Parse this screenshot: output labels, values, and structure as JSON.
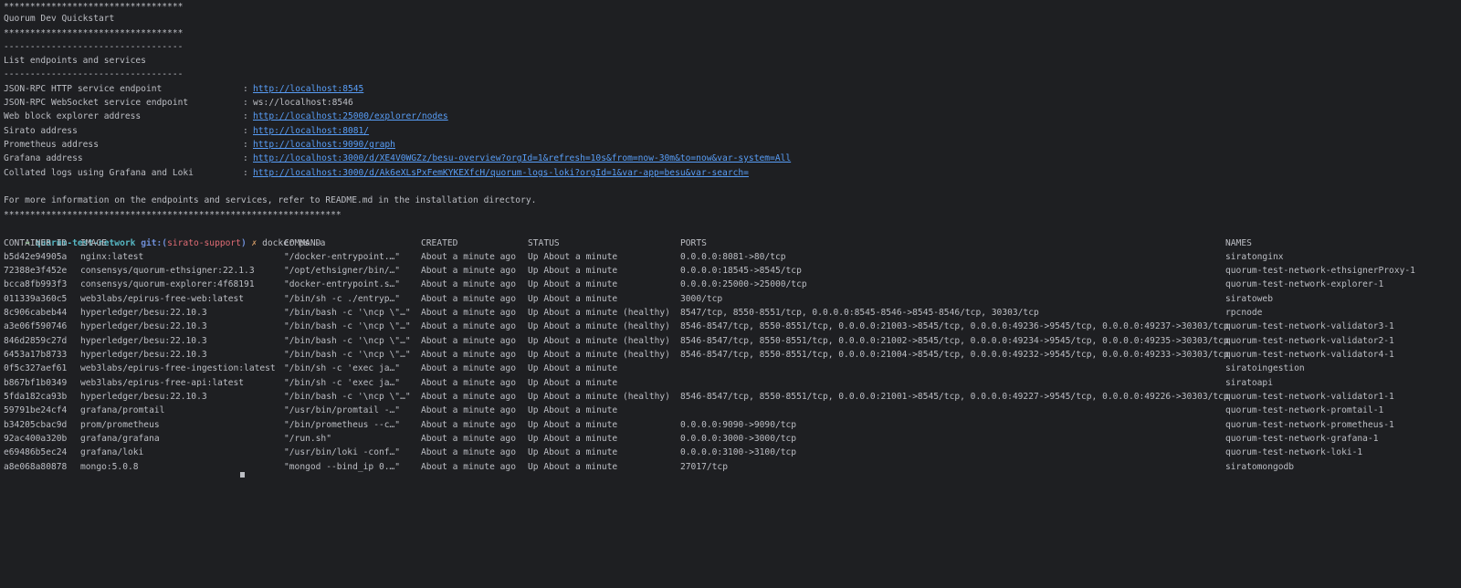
{
  "banner": {
    "stars_top": "**********************************",
    "title": "Quorum Dev Quickstart",
    "stars_bottom": "**********************************",
    "dashes_1": "----------------------------------",
    "list_heading": "List endpoints and services",
    "dashes_2": "----------------------------------"
  },
  "endpoints": [
    {
      "label": "JSON-RPC HTTP service endpoint",
      "value": "http://localhost:8545",
      "is_link": true
    },
    {
      "label": "JSON-RPC WebSocket service endpoint",
      "value": "ws://localhost:8546",
      "is_link": false
    },
    {
      "label": "Web block explorer address",
      "value": "http://localhost:25000/explorer/nodes",
      "is_link": true
    },
    {
      "label": "Sirato address",
      "value": "http://localhost:8081/",
      "is_link": true
    },
    {
      "label": "Prometheus address",
      "value": "http://localhost:9090/graph",
      "is_link": true
    },
    {
      "label": "Grafana address",
      "value": "http://localhost:3000/d/XE4V0WGZz/besu-overview?orgId=1&refresh=10s&from=now-30m&to=now&var-system=All",
      "is_link": true
    },
    {
      "label": "Collated logs using Grafana and Loki",
      "value": "http://localhost:3000/d/Ak6eXLsPxFemKYKEXfcH/quorum-logs-loki?orgId=1&var-app=besu&var-search=",
      "is_link": true
    }
  ],
  "separator": ":",
  "info_text": "For more information on the endpoints and services, refer to README.md in the installation directory.",
  "stars_long": "****************************************************************",
  "prompt": {
    "arrow": "➜",
    "dir": "quorum-test-network",
    "git_open": "git:(",
    "branch": "sirato-support",
    "git_close": ")",
    "mark": "✗",
    "command": "docker ps -a"
  },
  "docker_headers": {
    "container_id": "CONTAINER ID",
    "image": "IMAGE",
    "command": "COMMAND",
    "created": "CREATED",
    "status": "STATUS",
    "ports": "PORTS",
    "names": "NAMES"
  },
  "containers": [
    {
      "id": "b5d42e94905a",
      "image": "nginx:latest",
      "command": "\"/docker-entrypoint.…\"",
      "created": "About a minute ago",
      "status": "Up About a minute",
      "ports": "0.0.0.0:8081->80/tcp",
      "names": "siratonginx"
    },
    {
      "id": "72388e3f452e",
      "image": "consensys/quorum-ethsigner:22.1.3",
      "command": "\"/opt/ethsigner/bin/…\"",
      "created": "About a minute ago",
      "status": "Up About a minute",
      "ports": "0.0.0.0:18545->8545/tcp",
      "names": "quorum-test-network-ethsignerProxy-1"
    },
    {
      "id": "bcca8fb993f3",
      "image": "consensys/quorum-explorer:4f68191",
      "command": "\"docker-entrypoint.s…\"",
      "created": "About a minute ago",
      "status": "Up About a minute",
      "ports": "0.0.0.0:25000->25000/tcp",
      "names": "quorum-test-network-explorer-1"
    },
    {
      "id": "011339a360c5",
      "image": "web3labs/epirus-free-web:latest",
      "command": "\"/bin/sh -c ./entryp…\"",
      "created": "About a minute ago",
      "status": "Up About a minute",
      "ports": "3000/tcp",
      "names": "siratoweb"
    },
    {
      "id": "8c906cabeb44",
      "image": "hyperledger/besu:22.10.3",
      "command": "\"/bin/bash -c '\\ncp \\\"…\"",
      "created": "About a minute ago",
      "status": "Up About a minute (healthy)",
      "ports": "8547/tcp, 8550-8551/tcp, 0.0.0.0:8545-8546->8545-8546/tcp, 30303/tcp",
      "names": "rpcnode"
    },
    {
      "id": "a3e06f590746",
      "image": "hyperledger/besu:22.10.3",
      "command": "\"/bin/bash -c '\\ncp \\\"…\"",
      "created": "About a minute ago",
      "status": "Up About a minute (healthy)",
      "ports": "8546-8547/tcp, 8550-8551/tcp, 0.0.0.0:21003->8545/tcp, 0.0.0.0:49236->9545/tcp, 0.0.0.0:49237->30303/tcp",
      "names": "quorum-test-network-validator3-1"
    },
    {
      "id": "846d2859c27d",
      "image": "hyperledger/besu:22.10.3",
      "command": "\"/bin/bash -c '\\ncp \\\"…\"",
      "created": "About a minute ago",
      "status": "Up About a minute (healthy)",
      "ports": "8546-8547/tcp, 8550-8551/tcp, 0.0.0.0:21002->8545/tcp, 0.0.0.0:49234->9545/tcp, 0.0.0.0:49235->30303/tcp",
      "names": "quorum-test-network-validator2-1"
    },
    {
      "id": "6453a17b8733",
      "image": "hyperledger/besu:22.10.3",
      "command": "\"/bin/bash -c '\\ncp \\\"…\"",
      "created": "About a minute ago",
      "status": "Up About a minute (healthy)",
      "ports": "8546-8547/tcp, 8550-8551/tcp, 0.0.0.0:21004->8545/tcp, 0.0.0.0:49232->9545/tcp, 0.0.0.0:49233->30303/tcp",
      "names": "quorum-test-network-validator4-1"
    },
    {
      "id": "0f5c327aef61",
      "image": "web3labs/epirus-free-ingestion:latest",
      "command": "\"/bin/sh -c 'exec ja…\"",
      "created": "About a minute ago",
      "status": "Up About a minute",
      "ports": "",
      "names": "siratoingestion"
    },
    {
      "id": "b867bf1b0349",
      "image": "web3labs/epirus-free-api:latest",
      "command": "\"/bin/sh -c 'exec ja…\"",
      "created": "About a minute ago",
      "status": "Up About a minute",
      "ports": "",
      "names": "siratoapi"
    },
    {
      "id": "5fda182ca93b",
      "image": "hyperledger/besu:22.10.3",
      "command": "\"/bin/bash -c '\\ncp \\\"…\"",
      "created": "About a minute ago",
      "status": "Up About a minute (healthy)",
      "ports": "8546-8547/tcp, 8550-8551/tcp, 0.0.0.0:21001->8545/tcp, 0.0.0.0:49227->9545/tcp, 0.0.0.0:49226->30303/tcp",
      "names": "quorum-test-network-validator1-1"
    },
    {
      "id": "59791be24cf4",
      "image": "grafana/promtail",
      "command": "\"/usr/bin/promtail -…\"",
      "created": "About a minute ago",
      "status": "Up About a minute",
      "ports": "",
      "names": "quorum-test-network-promtail-1"
    },
    {
      "id": "b34205cbac9d",
      "image": "prom/prometheus",
      "command": "\"/bin/prometheus --c…\"",
      "created": "About a minute ago",
      "status": "Up About a minute",
      "ports": "0.0.0.0:9090->9090/tcp",
      "names": "quorum-test-network-prometheus-1"
    },
    {
      "id": "92ac400a320b",
      "image": "grafana/grafana",
      "command": "\"/run.sh\"",
      "created": "About a minute ago",
      "status": "Up About a minute",
      "ports": "0.0.0.0:3000->3000/tcp",
      "names": "quorum-test-network-grafana-1"
    },
    {
      "id": "e69486b5ec24",
      "image": "grafana/loki",
      "command": "\"/usr/bin/loki -conf…\"",
      "created": "About a minute ago",
      "status": "Up About a minute",
      "ports": "0.0.0.0:3100->3100/tcp",
      "names": "quorum-test-network-loki-1"
    },
    {
      "id": "a8e068a80878",
      "image": "mongo:5.0.8",
      "command": "\"mongod --bind_ip 0.…\"",
      "created": "About a minute ago",
      "status": "Up About a minute",
      "ports": "27017/tcp",
      "names": "siratomongodb"
    }
  ],
  "colors": {
    "background": "#1e1f22",
    "text": "#bcbec4",
    "link": "#589df6",
    "prompt_arrow": "#5fb85f",
    "prompt_dir": "#56b6c2",
    "git_label": "#6f8fd8",
    "branch": "#e06c75"
  }
}
